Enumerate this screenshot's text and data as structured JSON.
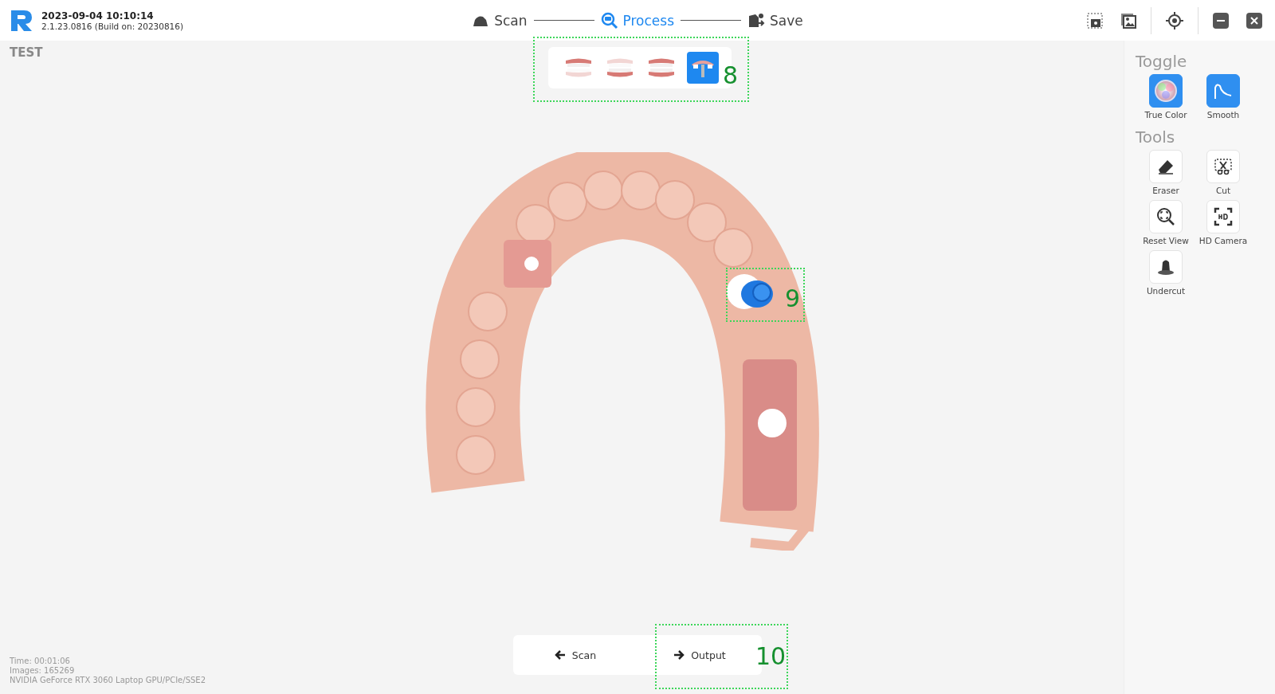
{
  "header": {
    "timestamp": "2023-09-04 10:10:14",
    "version": "2.1.23.0816 (Build on: 20230816)"
  },
  "steps": [
    {
      "label": "Scan",
      "kind": "scan",
      "selected": false
    },
    {
      "label": "Process",
      "kind": "process",
      "selected": true
    },
    {
      "label": "Save",
      "kind": "save",
      "selected": false
    }
  ],
  "project_name": "TEST",
  "model_views": [
    {
      "kind": "upper",
      "selected": false
    },
    {
      "kind": "lower",
      "selected": false
    },
    {
      "kind": "both",
      "selected": false
    },
    {
      "kind": "implant",
      "selected": true
    }
  ],
  "toggle": {
    "title": "Toggle",
    "items": [
      {
        "label": "True Color",
        "kind": "color",
        "on": true
      },
      {
        "label": "Smooth",
        "kind": "smooth",
        "on": true
      }
    ]
  },
  "tools": {
    "title": "Tools",
    "items": [
      {
        "label": "Eraser",
        "kind": "eraser"
      },
      {
        "label": "Cut",
        "kind": "cut"
      },
      {
        "label": "Reset View",
        "kind": "reset"
      },
      {
        "label": "HD Camera",
        "kind": "hd"
      },
      {
        "label": "Undercut",
        "kind": "undercut"
      }
    ]
  },
  "stats": [
    "Time: 00:01:06",
    "Images: 165269",
    "NVIDIA GeForce RTX 3060 Laptop GPU/PCIe/SSE2"
  ],
  "nav": [
    {
      "label": "Scan",
      "kind": "back"
    },
    {
      "label": "Output",
      "kind": "forward"
    }
  ],
  "callouts": [
    {
      "label": "8",
      "kind": "model_views"
    },
    {
      "label": "9",
      "kind": "implant"
    },
    {
      "label": "10",
      "kind": "output"
    }
  ]
}
